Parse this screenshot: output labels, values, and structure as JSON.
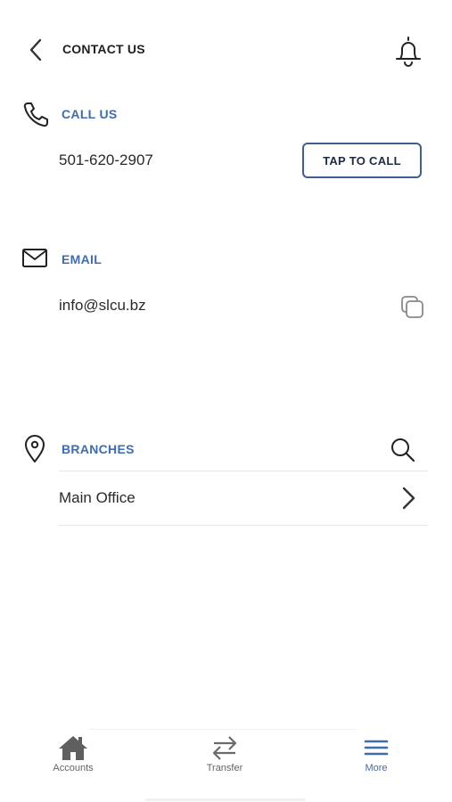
{
  "header": {
    "title": "CONTACT US",
    "back_icon": "chevron-left-icon",
    "notify_icon": "bell-icon"
  },
  "call": {
    "section_label": "CALL US",
    "phone": "501-620-2907",
    "button_label": "TAP TO CALL",
    "icon": "phone-icon"
  },
  "email": {
    "section_label": "EMAIL",
    "address": "info@slcu.bz",
    "icon": "mail-icon",
    "copy_icon": "copy-icon"
  },
  "branches": {
    "section_label": "BRANCHES",
    "icon": "location-pin-icon",
    "search_icon": "search-icon",
    "items": [
      {
        "label": "Main Office"
      }
    ]
  },
  "tabbar": {
    "tabs": [
      {
        "label": "Accounts",
        "icon": "home-icon",
        "active": false
      },
      {
        "label": "Transfer",
        "icon": "transfer-icon",
        "active": false
      },
      {
        "label": "More",
        "icon": "menu-icon",
        "active": true
      }
    ]
  },
  "colors": {
    "accent": "#3f6cb0",
    "button_border": "#3f5f94",
    "text": "#222222"
  }
}
